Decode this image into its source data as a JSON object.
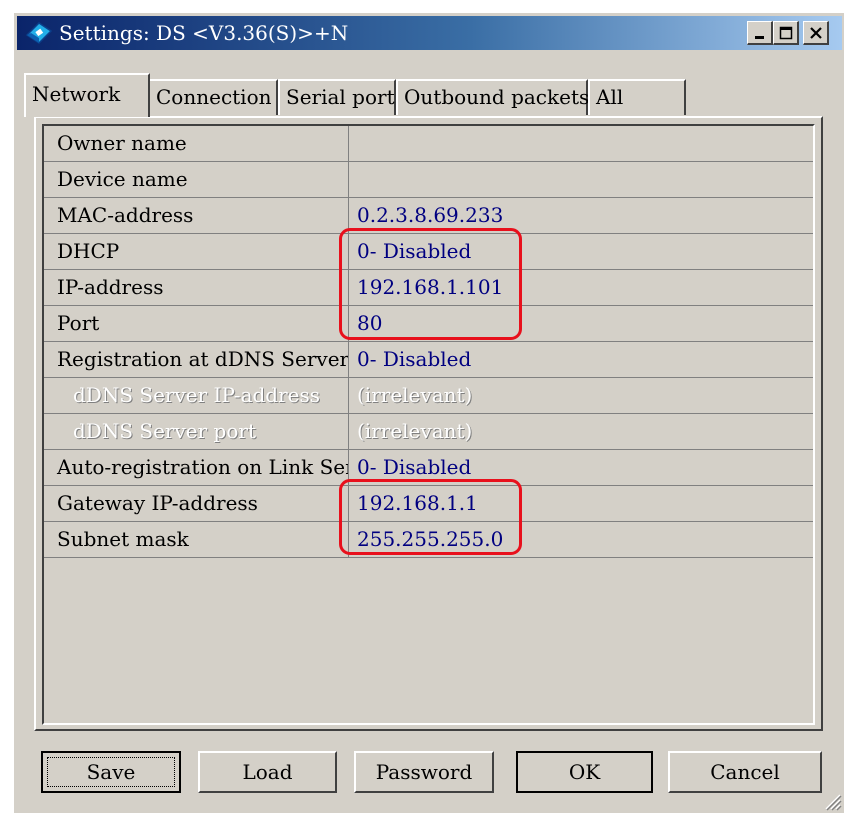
{
  "window": {
    "title": "Settings: DS <V3.36(S)>+N",
    "icons": {
      "app": "settings-app-icon",
      "minimize": "minimize-icon",
      "maximize": "maximize-icon",
      "close": "close-icon"
    }
  },
  "tabs": [
    {
      "label": "Network",
      "active": true
    },
    {
      "label": "Connection",
      "active": false
    },
    {
      "label": "Serial port",
      "active": false
    },
    {
      "label": "Outbound packets",
      "active": false
    },
    {
      "label": "All",
      "active": false
    }
  ],
  "settings": {
    "rows": [
      {
        "name": "Owner name",
        "value": ""
      },
      {
        "name": "Device name",
        "value": ""
      },
      {
        "name": "MAC-address",
        "value": "0.2.3.8.69.233"
      },
      {
        "name": "DHCP",
        "value": "0- Disabled"
      },
      {
        "name": "IP-address",
        "value": "192.168.1.101"
      },
      {
        "name": "Port",
        "value": "80"
      },
      {
        "name": "Registration at dDNS Server",
        "value": "0- Disabled"
      },
      {
        "name": "dDNS Server IP-address",
        "value": "(irrelevant)"
      },
      {
        "name": "dDNS Server port",
        "value": "(irrelevant)"
      },
      {
        "name": "Auto-registration on Link Server",
        "value": "0- Disabled"
      },
      {
        "name": "Gateway IP-address",
        "value": "192.168.1.1"
      },
      {
        "name": "Subnet mask",
        "value": "255.255.255.0"
      }
    ]
  },
  "buttons": {
    "save": "Save",
    "load": "Load",
    "password": "Password",
    "ok": "OK",
    "cancel": "Cancel"
  },
  "colors": {
    "value_text": "#000080",
    "highlight": "#e8101c",
    "title_bar_start": "#0a246a",
    "title_bar_end": "#a6caf0",
    "face": "#d4d0c8"
  }
}
